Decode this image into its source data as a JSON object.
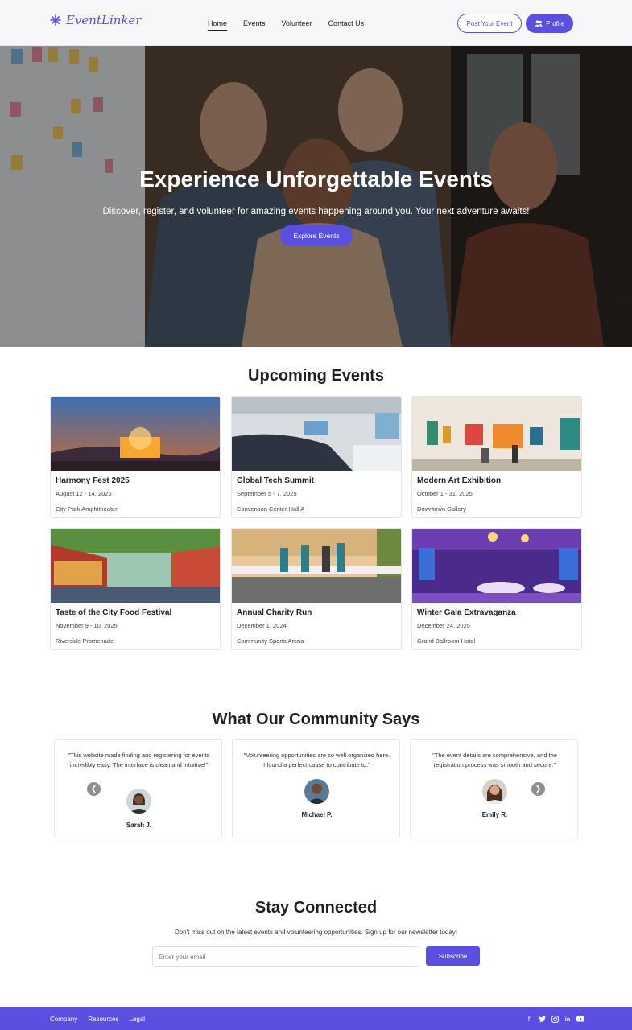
{
  "brand": {
    "name": "EventLinker",
    "accent": "#5a4fe0"
  },
  "nav": {
    "links": [
      "Home",
      "Events",
      "Volunteer",
      "Contact Us"
    ],
    "post_event": "Post Your Event",
    "profile": "Profile"
  },
  "hero": {
    "title": "Experience Unforgettable Events",
    "subtitle": "Discover, register, and volunteer for amazing events happening around you. Your next adventure awaits!",
    "cta": "Explore Events"
  },
  "events": {
    "title": "Upcoming Events",
    "items": [
      {
        "name": "Harmony Fest 2025",
        "date": "August 12 - 14, 2025",
        "location": "City Park Amphitheater"
      },
      {
        "name": "Global Tech Summit",
        "date": "September 5 - 7, 2025",
        "location": "Convention Center Hall A"
      },
      {
        "name": "Modern Art Exhibition",
        "date": "October 1 - 31, 2025",
        "location": "Downtown Gallery"
      },
      {
        "name": "Taste of the City Food Festival",
        "date": "November 9 - 10, 2025",
        "location": "Riverside Promenade"
      },
      {
        "name": "Annual Charity Run",
        "date": "December 1, 2024",
        "location": "Community Sports Arena"
      },
      {
        "name": "Winter Gala Extravaganza",
        "date": "December 24, 2025",
        "location": "Grand Ballroom Hotel"
      }
    ]
  },
  "testimonials": {
    "title": "What Our Community Says",
    "items": [
      {
        "quote": "\"This website made finding and registering for events incredibly easy. The interface is clean and intuitive!\"",
        "name": "Sarah J."
      },
      {
        "quote": "\"Volunteering opportunities are so well organized here. I found a perfect cause to contribute to.\"",
        "name": "Michael P."
      },
      {
        "quote": "\"The event details are comprehensive, and the registration process was smooth and secure.\"",
        "name": "Emily R."
      }
    ]
  },
  "newsletter": {
    "title": "Stay Connected",
    "subtitle": "Don't miss out on the latest events and volunteering opportunities. Sign up for our newsletter today!",
    "placeholder": "Enter your email",
    "button": "Subscribe"
  },
  "footer": {
    "links": [
      "Company",
      "Resources",
      "Legal"
    ],
    "icons": [
      "facebook-icon",
      "twitter-icon",
      "instagram-icon",
      "linkedin-icon",
      "youtube-icon"
    ]
  }
}
